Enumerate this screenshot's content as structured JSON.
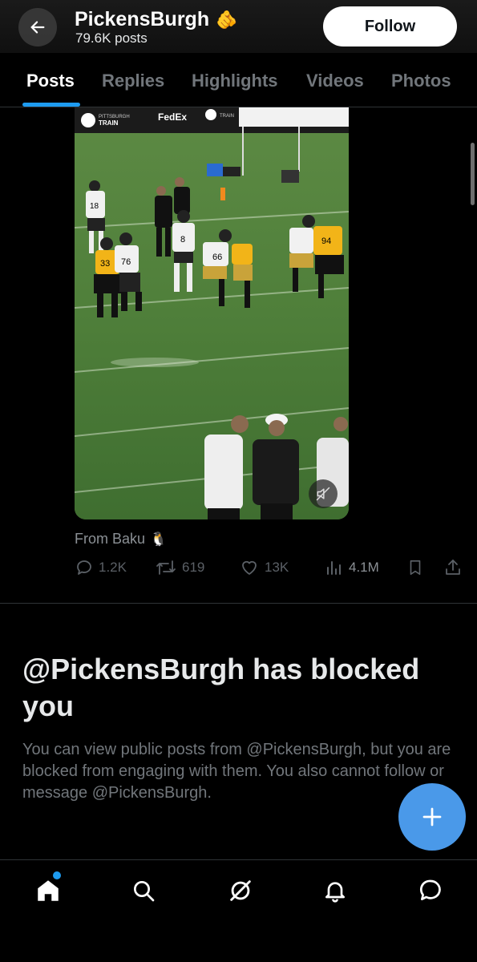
{
  "header": {
    "profile_name": "PickensBurgh",
    "name_emoji": "🫵",
    "post_count": "79.6K posts",
    "follow_label": "Follow"
  },
  "tabs": [
    {
      "label": "Posts",
      "active": true
    },
    {
      "label": "Replies",
      "active": false
    },
    {
      "label": "Highlights",
      "active": false
    },
    {
      "label": "Videos",
      "active": false
    },
    {
      "label": "Photos",
      "active": false
    }
  ],
  "post": {
    "from_text": "From Baku",
    "from_emoji": "🐧",
    "video_signs": [
      "PITTSBURGH",
      "TRAIN",
      "FedEx",
      "TRAIN"
    ],
    "jersey_numbers": [
      "18",
      "8",
      "33",
      "76",
      "66",
      "94"
    ],
    "stats": {
      "replies": "1.2K",
      "reposts": "619",
      "likes": "13K",
      "views": "4.1M"
    }
  },
  "blocked": {
    "title": "@PickensBurgh has blocked you",
    "description": "You can view public posts from @PickensBurgh, but you are blocked from engaging with them. You also cannot follow or message @PickensBurgh."
  },
  "nav": [
    "home-icon",
    "search-icon",
    "grok-icon",
    "notifications-icon",
    "messages-icon"
  ],
  "colors": {
    "accent": "#1d9bf0",
    "fab": "#4a99e9",
    "background": "#000000"
  }
}
